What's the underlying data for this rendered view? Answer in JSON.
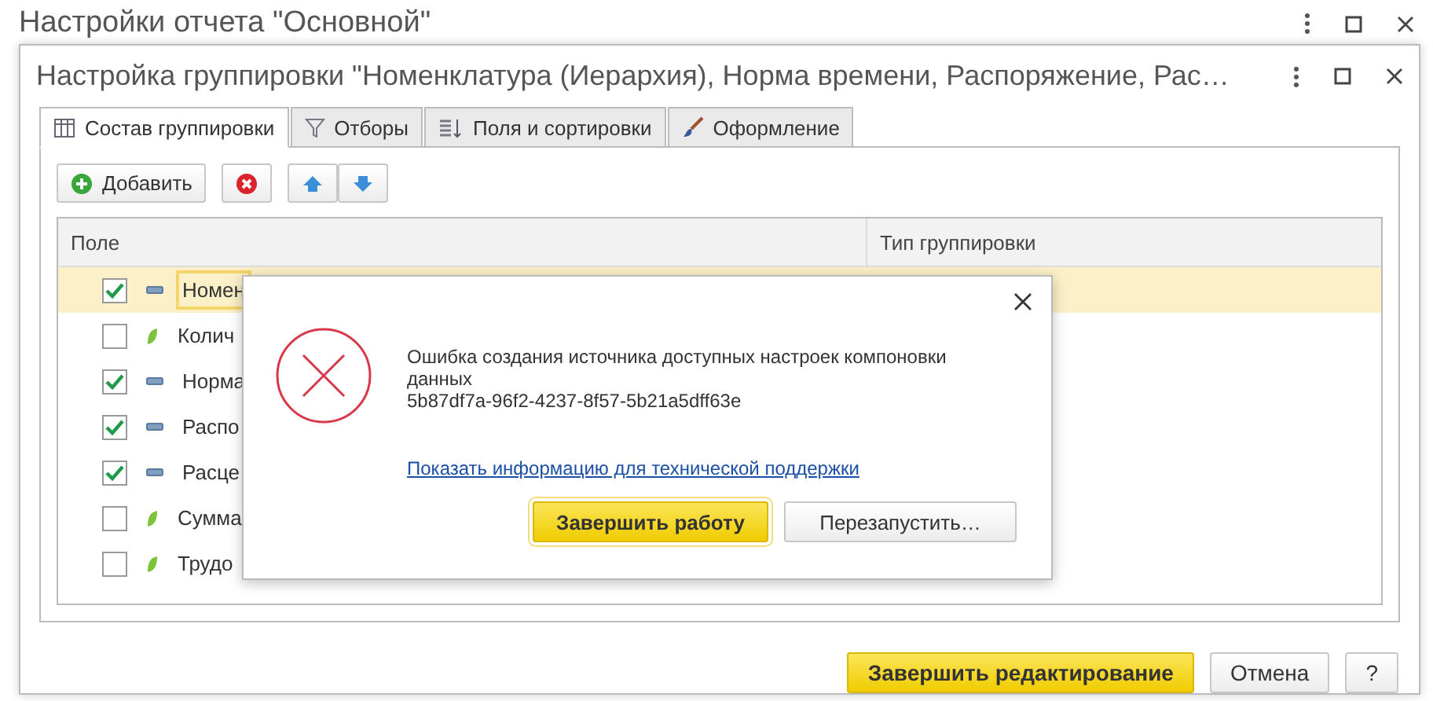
{
  "outer_window": {
    "title": "Настройки отчета \"Основной\""
  },
  "window": {
    "title": "Настройка группировки \"Номенклатура (Иерархия), Норма времени, Распоряжение, Рас…"
  },
  "tabs": [
    {
      "label": "Состав группировки",
      "selected": true,
      "kind": "table"
    },
    {
      "label": "Отборы",
      "selected": false,
      "kind": "filter"
    },
    {
      "label": "Поля и сортировки",
      "selected": false,
      "kind": "sort"
    },
    {
      "label": "Оформление",
      "selected": false,
      "kind": "brush"
    }
  ],
  "toolbar": {
    "add_label": "Добавить"
  },
  "table": {
    "columns": [
      "Поле",
      "Тип группировки"
    ],
    "rows": [
      {
        "field": "Номен",
        "checked": true,
        "kind": "dimension",
        "selected": true
      },
      {
        "field": "Колич",
        "checked": false,
        "kind": "resource",
        "selected": false
      },
      {
        "field": "Норма",
        "checked": true,
        "kind": "dimension",
        "selected": false
      },
      {
        "field": "Распо",
        "checked": true,
        "kind": "dimension",
        "selected": false
      },
      {
        "field": "Расце",
        "checked": true,
        "kind": "dimension",
        "selected": false
      },
      {
        "field": "Сумма",
        "checked": false,
        "kind": "resource",
        "selected": false
      },
      {
        "field": "Трудо",
        "checked": false,
        "kind": "resource",
        "selected": false
      }
    ]
  },
  "dialog": {
    "message": "Ошибка создания источника доступных настроек компоновки данных",
    "code": "5b87df7a-96f2-4237-8f57-5b21a5dff63e",
    "link": "Показать информацию для технической поддержки",
    "buttons": [
      {
        "label": "Завершить работу",
        "primary": true
      },
      {
        "label": "Перезапустить…",
        "primary": false
      }
    ]
  },
  "footer": {
    "buttons": [
      {
        "label": "Завершить редактирование",
        "primary": true
      },
      {
        "label": "Отмена",
        "primary": false
      },
      {
        "label": "?",
        "primary": false
      }
    ]
  }
}
